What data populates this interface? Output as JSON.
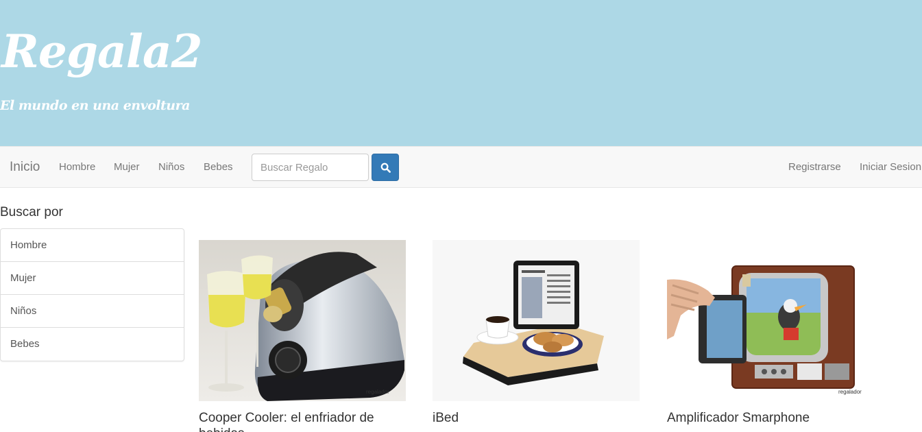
{
  "header": {
    "title": "Regala2",
    "tagline": "El mundo en una envoltura"
  },
  "navbar": {
    "home": "Inicio",
    "items": [
      "Hombre",
      "Mujer",
      "Niños",
      "Bebes"
    ],
    "search": {
      "placeholder": "Buscar Regalo",
      "icon": "search-icon"
    },
    "register": "Registrarse",
    "login": "Iniciar Sesion"
  },
  "sidebar": {
    "heading": "Buscar por",
    "items": [
      "Hombre",
      "Mujer",
      "Niños",
      "Bebes"
    ]
  },
  "products": [
    {
      "title": "Cooper Cooler: el enfriador de bebidas"
    },
    {
      "title": "iBed"
    },
    {
      "title": "Amplificador Smarphone"
    }
  ],
  "colors": {
    "banner": "#add8e6",
    "navbar": "#f8f8f8",
    "primary_button": "#337ab7"
  }
}
